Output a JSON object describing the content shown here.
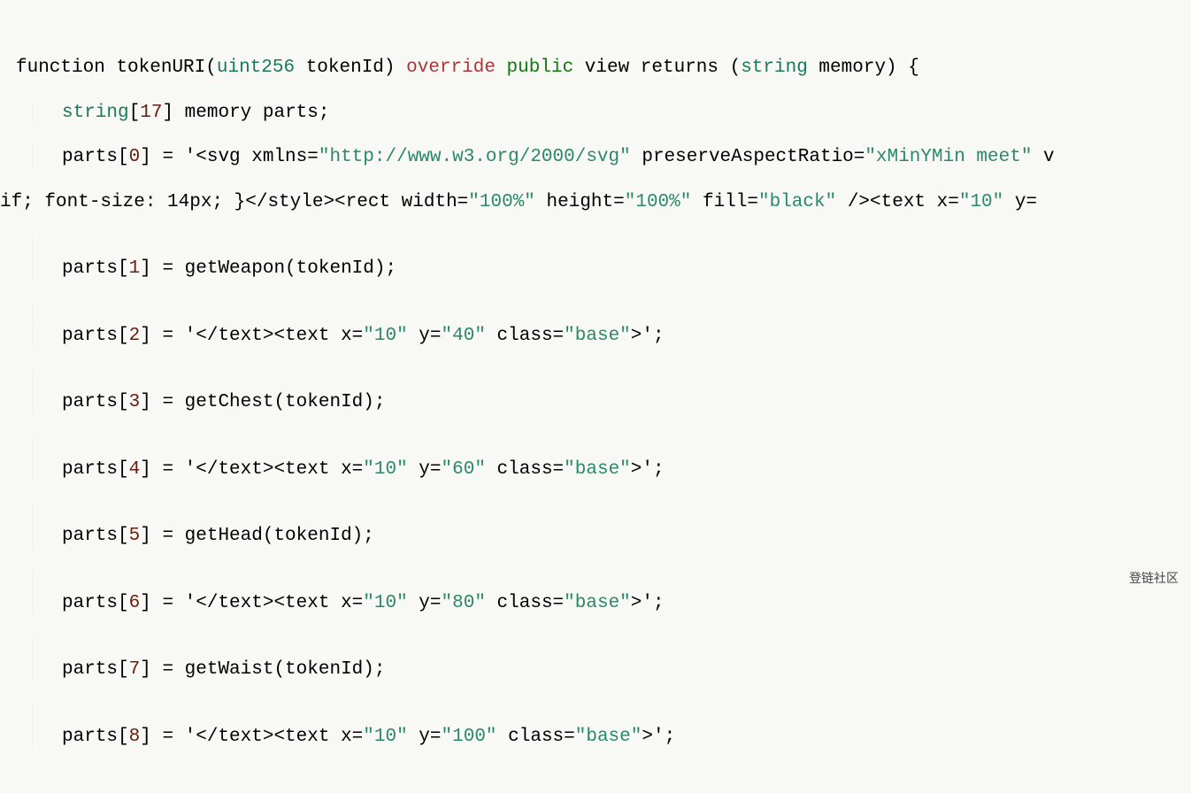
{
  "code": {
    "sig": {
      "keyword_function": "function",
      "name": "tokenURI",
      "paren_open": "(",
      "param_type": "uint256",
      "param_name": " tokenId",
      "paren_close": ")",
      "override": " override",
      "public": " public",
      "view_returns": " view returns (",
      "return_type": "string",
      "memory": " memory) {"
    },
    "decl": {
      "type": "string",
      "arr_open": "[",
      "arr_size": "17",
      "arr_close": "] memory parts;"
    },
    "line0": {
      "prefix": "parts[",
      "idx": "0",
      "after_idx": "] = '<svg xmlns=",
      "url": "\"http://www.w3.org/2000/svg\"",
      "mid1": " preserveAspectRatio=",
      "val1": "\"xMinYMin meet\"",
      "tail": " v"
    },
    "wrap": {
      "lead": "if; font-size: 14px; }</style><rect width=",
      "v1": "\"100%\"",
      "mid1": " height=",
      "v2": "\"100%\"",
      "mid2": " fill=",
      "v3": "\"black\"",
      "mid3": " /><text x=",
      "v4": "\"10\"",
      "mid4": " y="
    },
    "line1": {
      "prefix": "parts[",
      "idx": "1",
      "rest": "] = getWeapon(tokenId);"
    },
    "line2": {
      "prefix": "parts[",
      "idx": "2",
      "after": "] = '</text><text x=",
      "x": "\"10\"",
      "mid1": " y=",
      "y": "\"40\"",
      "mid2": " class=",
      "cls": "\"base\"",
      "end": ">';"
    },
    "line3": {
      "prefix": "parts[",
      "idx": "3",
      "rest": "] = getChest(tokenId);"
    },
    "line4": {
      "prefix": "parts[",
      "idx": "4",
      "after": "] = '</text><text x=",
      "x": "\"10\"",
      "mid1": " y=",
      "y": "\"60\"",
      "mid2": " class=",
      "cls": "\"base\"",
      "end": ">';"
    },
    "line5": {
      "prefix": "parts[",
      "idx": "5",
      "rest": "] = getHead(tokenId);"
    },
    "line6": {
      "prefix": "parts[",
      "idx": "6",
      "after": "] = '</text><text x=",
      "x": "\"10\"",
      "mid1": " y=",
      "y": "\"80\"",
      "mid2": " class=",
      "cls": "\"base\"",
      "end": ">';"
    },
    "line7": {
      "prefix": "parts[",
      "idx": "7",
      "rest": "] = getWaist(tokenId);"
    },
    "line8": {
      "prefix": "parts[",
      "idx": "8",
      "after": "] = '</text><text x=",
      "x": "\"10\"",
      "mid1": " y=",
      "y": "\"100\"",
      "mid2": " class=",
      "cls": "\"base\"",
      "end": ">';"
    }
  },
  "watermark": "登链社区"
}
